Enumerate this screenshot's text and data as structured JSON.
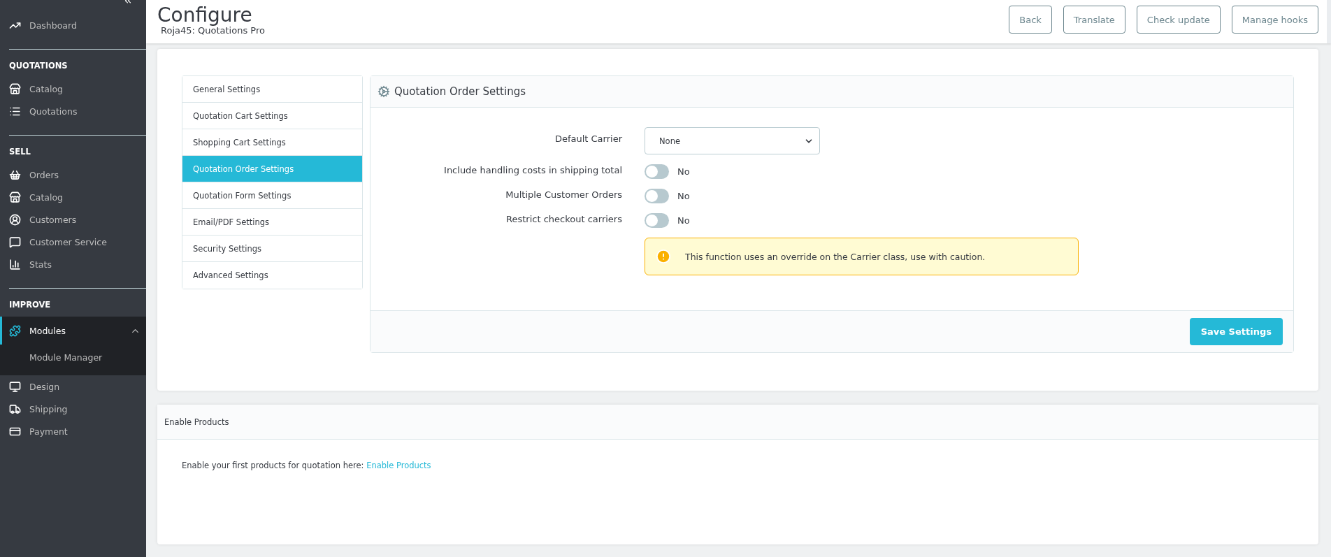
{
  "sidebar": {
    "sections": [
      {
        "items": [
          {
            "label": "Dashboard",
            "selected": false
          }
        ]
      },
      {
        "heading": "QUOTATIONS",
        "items": [
          {
            "label": "Catalog",
            "selected": false
          },
          {
            "label": "Quotations",
            "selected": false
          }
        ]
      },
      {
        "heading": "SELL",
        "items": [
          {
            "label": "Orders",
            "selected": false
          },
          {
            "label": "Catalog",
            "selected": false
          },
          {
            "label": "Customers",
            "selected": false
          },
          {
            "label": "Customer Service",
            "selected": false
          },
          {
            "label": "Stats",
            "selected": false
          }
        ]
      },
      {
        "heading": "IMPROVE",
        "items": [
          {
            "label": "Modules",
            "selected": true,
            "expanded": true,
            "children": [
              {
                "label": "Module Manager"
              }
            ]
          },
          {
            "label": "Design",
            "selected": false
          },
          {
            "label": "Shipping",
            "selected": false
          },
          {
            "label": "Payment",
            "selected": false
          }
        ]
      }
    ]
  },
  "header": {
    "title": "Configure",
    "subtitle": "Roja45: Quotations Pro",
    "buttons": [
      "Back",
      "Translate",
      "Check update",
      "Manage hooks"
    ]
  },
  "tabs": [
    {
      "label": "General Settings",
      "selected": false
    },
    {
      "label": "Quotation Cart Settings",
      "selected": false
    },
    {
      "label": "Shopping Cart Settings",
      "selected": false
    },
    {
      "label": "Quotation Order Settings",
      "selected": true
    },
    {
      "label": "Quotation Form Settings",
      "selected": false
    },
    {
      "label": "Email/PDF Settings",
      "selected": false
    },
    {
      "label": "Security Settings",
      "selected": false
    },
    {
      "label": "Advanced Settings",
      "selected": false
    }
  ],
  "panel": {
    "title": "Quotation Order Settings",
    "fields": [
      {
        "kind": "select",
        "label": "Default Carrier",
        "value": "None"
      },
      {
        "kind": "toggle",
        "label": "Include handling costs in shipping total",
        "on": false,
        "state_label": "No"
      },
      {
        "kind": "toggle",
        "label": "Multiple Customer Orders",
        "on": false,
        "state_label": "No"
      },
      {
        "kind": "toggle",
        "label": "Restrict checkout carriers",
        "on": false,
        "state_label": "No"
      }
    ],
    "alert": "This function uses an override on the Carrier class, use with caution.",
    "save_button": "Save Settings"
  },
  "enable_card": {
    "title": "Enable Products",
    "text": "Enable your first products for quotation here:",
    "link": "Enable Products"
  }
}
